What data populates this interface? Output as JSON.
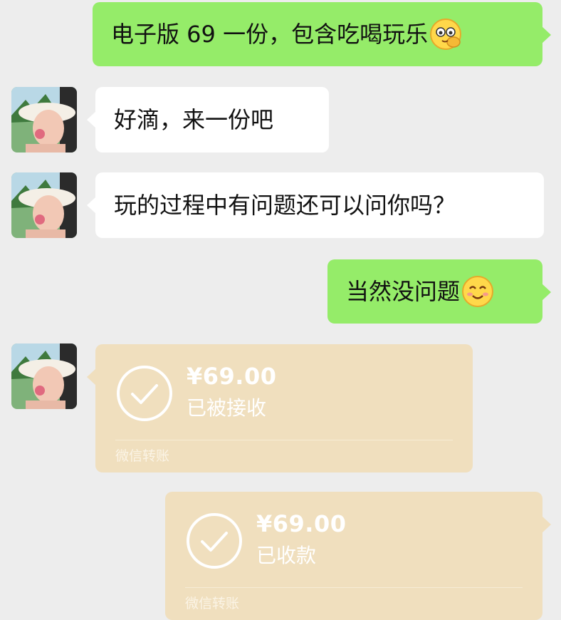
{
  "messages": [
    {
      "sender": "me",
      "text": "电子版 69 一份，包含吃喝玩乐",
      "emoji": "peeking-face-emoji"
    },
    {
      "sender": "contact",
      "text": "好滴，来一份吧"
    },
    {
      "sender": "contact",
      "text": "玩的过程中有问题还可以问你吗？"
    },
    {
      "sender": "me",
      "text": "当然没问题",
      "emoji": "smiling-face-emoji"
    },
    {
      "sender": "contact",
      "type": "transfer",
      "amount": "¥69.00",
      "status": "已被接收",
      "label": "微信转账"
    },
    {
      "sender": "me",
      "type": "transfer",
      "amount": "¥69.00",
      "status": "已收款",
      "label": "微信转账"
    }
  ],
  "colors": {
    "background": "#ededed",
    "outgoing_bubble": "#95ec69",
    "incoming_bubble": "#ffffff",
    "transfer_card": "#f0dfbe"
  },
  "icons": {
    "avatar": "contact-avatar-photo",
    "transfer_status": "check-circle-icon"
  }
}
